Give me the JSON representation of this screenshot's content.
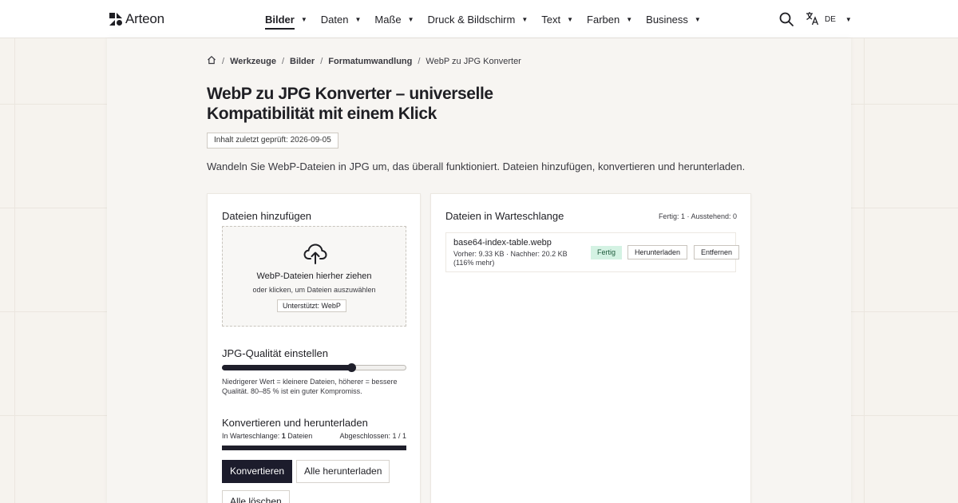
{
  "header": {
    "brand": "Arteon",
    "nav": [
      {
        "label": "Bilder",
        "active": true
      },
      {
        "label": "Daten",
        "active": false
      },
      {
        "label": "Maße",
        "active": false
      },
      {
        "label": "Druck & Bildschirm",
        "active": false
      },
      {
        "label": "Text",
        "active": false
      },
      {
        "label": "Farben",
        "active": false
      },
      {
        "label": "Business",
        "active": false
      }
    ],
    "search_icon": "search-icon",
    "language": "DE",
    "language_icon": "translate-icon"
  },
  "breadcrumb": {
    "home_icon": "home-icon",
    "items": [
      "Werkzeuge",
      "Bilder",
      "Formatumwandlung"
    ],
    "current": "WebP zu JPG Konverter"
  },
  "page": {
    "title": "WebP zu JPG Konverter – universelle Kompatibilität mit einem Klick",
    "review_badge": "Inhalt zuletzt geprüft: 2026-09-05",
    "lead": "Wandeln Sie WebP-Dateien in JPG um, das überall funktioniert. Dateien hinzufügen, konvertieren und herunterladen."
  },
  "upload": {
    "heading": "Dateien hinzufügen",
    "icon": "cloud-upload-icon",
    "drop_title": "WebP-Dateien hierher ziehen",
    "drop_sub": "oder klicken, um Dateien auszuwählen",
    "supported": "Unterstützt: WebP"
  },
  "quality": {
    "heading": "JPG-Qualität einstellen",
    "value_fraction": 0.7,
    "hint": "Niedrigerer Wert = kleinere Dateien, höherer = bessere Qualität. 80–85 % ist ein guter Kompromiss."
  },
  "convert": {
    "heading": "Konvertieren und herunterladen",
    "queue_prefix": "In Warteschlange:",
    "queue_count": "1",
    "queue_suffix": "Dateien",
    "completed": "Abgeschlossen: 1 / 1",
    "progress_fraction": 1.0,
    "convert_button": "Konvertieren",
    "download_all_button": "Alle herunterladen",
    "clear_button": "Alle löschen"
  },
  "queue": {
    "heading": "Dateien in Warteschlange",
    "stats": "Fertig: 1 · Ausstehend: 0",
    "items": [
      {
        "name": "base64-index-table.webp",
        "meta": "Vorher: 9.33 KB · Nachher: 20.2 KB (116% mehr)",
        "status": "Fertig",
        "download": "Herunterladen",
        "remove": "Entfernen"
      }
    ]
  },
  "colors": {
    "accent_dark": "#1c1c2c",
    "status_done_bg": "#d4f2e3",
    "status_done_text": "#1f5b3c"
  }
}
